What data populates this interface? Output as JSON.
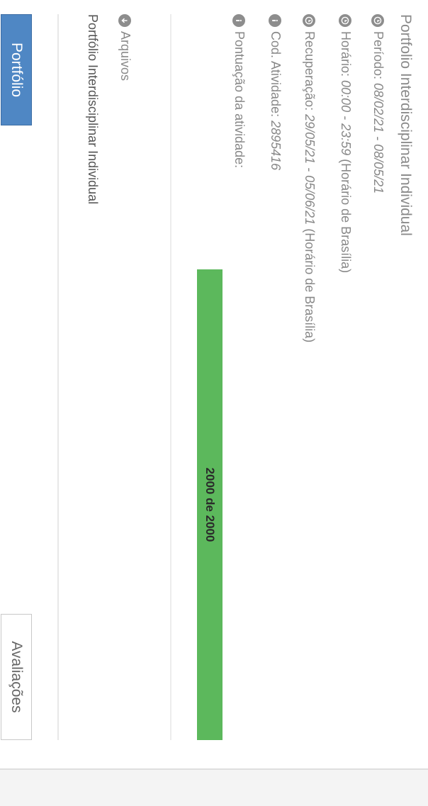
{
  "activity": {
    "title": "Portfolio Interdisciplinar Individual",
    "periodo_label": "Período:",
    "periodo_value": "08/02/21 - 08/05/21",
    "horario_label": "Horário:",
    "horario_value": "00:00 - 23:59",
    "horario_suffix": "(Horário de Brasília)",
    "recuperacao_label": "Recuperação:",
    "recuperacao_value": "29/05/21 - 05/06/21",
    "recuperacao_suffix": "(Horário de Brasília)",
    "cod_label": "Cod. Atividade:",
    "cod_value": "2895416",
    "pontuacao_label": "Pontuação da atividade:",
    "pontuacao_text": "2000 de 2000",
    "pontuacao_fraction": 1.0
  },
  "files": {
    "link_label": "Arquivos",
    "document_name": "Portfólio Interdisciplinar Individual"
  },
  "tabs": {
    "portfolio": "Portfólio",
    "avaliacoes": "Avaliações"
  },
  "colors": {
    "progress": "#5cb85c",
    "active_tab": "#4f87c4"
  }
}
